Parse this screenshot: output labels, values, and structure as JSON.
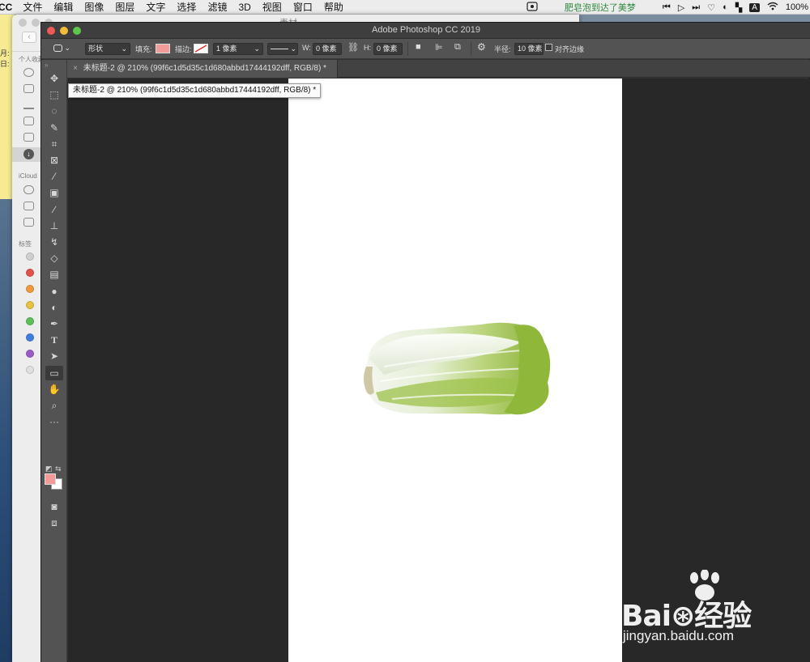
{
  "menubar": {
    "app": "CC",
    "items": [
      "文件",
      "编辑",
      "图像",
      "图层",
      "文字",
      "选择",
      "滤镜",
      "3D",
      "视图",
      "窗口",
      "帮助"
    ],
    "notification": "肥皂泡到达了美梦",
    "battery": "100%"
  },
  "notes": {
    "lines": [
      "月:",
      "日:"
    ]
  },
  "finder": {
    "title": "素材",
    "back_glyph": "‹",
    "section_personal": "个人收藏",
    "section_icloud": "iCloud",
    "section_tags": "标签",
    "tag_colors": [
      "#d0d0d0",
      "#e0524a",
      "#ee9a3d",
      "#e6c142",
      "#5cbf5a",
      "#3f7ee0",
      "#9a5bc7",
      "#e0e0e0"
    ]
  },
  "photoshop": {
    "window_title": "Adobe Photoshop CC 2019",
    "options": {
      "mode": "形状",
      "fill_label": "填充:",
      "fill_color": "#f29b98",
      "stroke_label": "描边:",
      "stroke_width": "1 像素",
      "w_label": "W:",
      "w_value": "0 像素",
      "h_label": "H:",
      "h_value": "0 像素",
      "radius_label": "半径:",
      "radius_value": "10 像素",
      "align_edges": "对齐边缘"
    },
    "tab": {
      "close": "×",
      "title": "未标题-2 @ 210% (99f6c1d5d35c1d680abbd17444192dff, RGB/8) *"
    },
    "tooltip": "未标题-2 @ 210% (99f6c1d5d35c1d680abbd17444192dff, RGB/8) *",
    "tools": [
      {
        "name": "move-tool",
        "glyph": "✥"
      },
      {
        "name": "marquee-tool",
        "glyph": "⬚"
      },
      {
        "name": "lasso-tool",
        "glyph": "◌"
      },
      {
        "name": "quick-select-tool",
        "glyph": "✎"
      },
      {
        "name": "crop-tool",
        "glyph": "⌗"
      },
      {
        "name": "frame-tool",
        "glyph": "⊠"
      },
      {
        "name": "eyedropper-tool",
        "glyph": "⁄"
      },
      {
        "name": "healing-tool",
        "glyph": "▣"
      },
      {
        "name": "brush-tool",
        "glyph": "∕"
      },
      {
        "name": "stamp-tool",
        "glyph": "⊥"
      },
      {
        "name": "history-brush-tool",
        "glyph": "↯"
      },
      {
        "name": "eraser-tool",
        "glyph": "◇"
      },
      {
        "name": "gradient-tool",
        "glyph": "▤"
      },
      {
        "name": "blur-tool",
        "glyph": "●"
      },
      {
        "name": "dodge-tool",
        "glyph": "◐"
      },
      {
        "name": "pen-tool",
        "glyph": "✒"
      },
      {
        "name": "type-tool",
        "glyph": "T"
      },
      {
        "name": "path-select-tool",
        "glyph": "➤"
      },
      {
        "name": "rectangle-tool",
        "glyph": "▭"
      },
      {
        "name": "hand-tool",
        "glyph": "✋"
      },
      {
        "name": "zoom-tool",
        "glyph": "⌕"
      },
      {
        "name": "more-tools",
        "glyph": "···"
      }
    ],
    "foreground_color": "#f29b98",
    "background_color": "#ffffff"
  },
  "watermark": {
    "brand": "Bai⊛经验",
    "url": "jingyan.baidu.com"
  }
}
